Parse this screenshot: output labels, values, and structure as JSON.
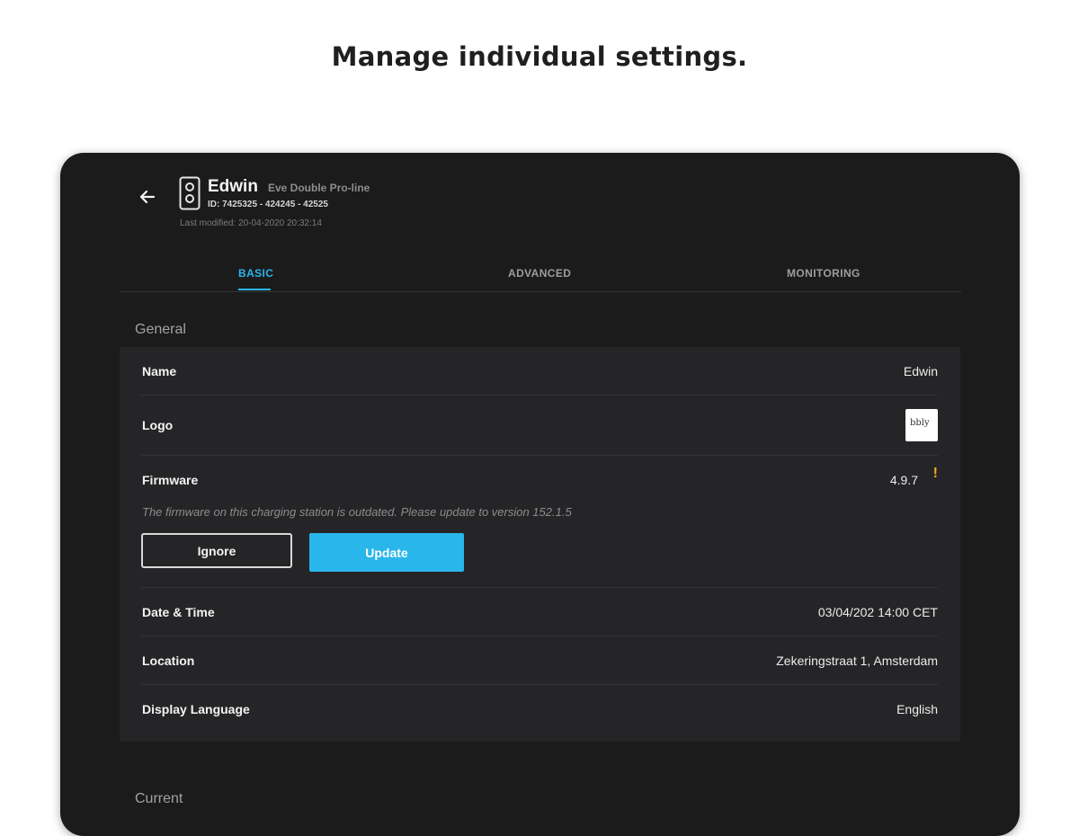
{
  "headline": "Manage individual settings.",
  "station": {
    "name": "Edwin",
    "model": "Eve Double Pro-line",
    "id_line": "ID: 7425325 - 424245 - 42525",
    "last_modified": "Last modified: 20-04-2020 20:32:14"
  },
  "tabs": [
    {
      "label": "BASIC",
      "active": true
    },
    {
      "label": "ADVANCED",
      "active": false
    },
    {
      "label": "MONITORING",
      "active": false
    }
  ],
  "sections": {
    "general": "General",
    "current": "Current"
  },
  "settings": {
    "name": {
      "label": "Name",
      "value": "Edwin"
    },
    "logo": {
      "label": "Logo",
      "thumb_text": "bbly"
    },
    "firmware": {
      "label": "Firmware",
      "value": "4.9.7",
      "warning_icon": "exclamation-icon",
      "note": "The firmware on this charging station is outdated. Please update to version 152.1.5",
      "ignore_label": "Ignore",
      "update_label": "Update"
    },
    "datetime": {
      "label": "Date & Time",
      "value": "03/04/202 14:00 CET"
    },
    "location": {
      "label": "Location",
      "value": "Zekeringstraat 1, Amsterdam"
    },
    "language": {
      "label": "Display Language",
      "value": "English"
    }
  },
  "colors": {
    "accent": "#29b6ea",
    "warning": "#f5a623",
    "background": "#1b1b1c",
    "panel": "#252527"
  }
}
